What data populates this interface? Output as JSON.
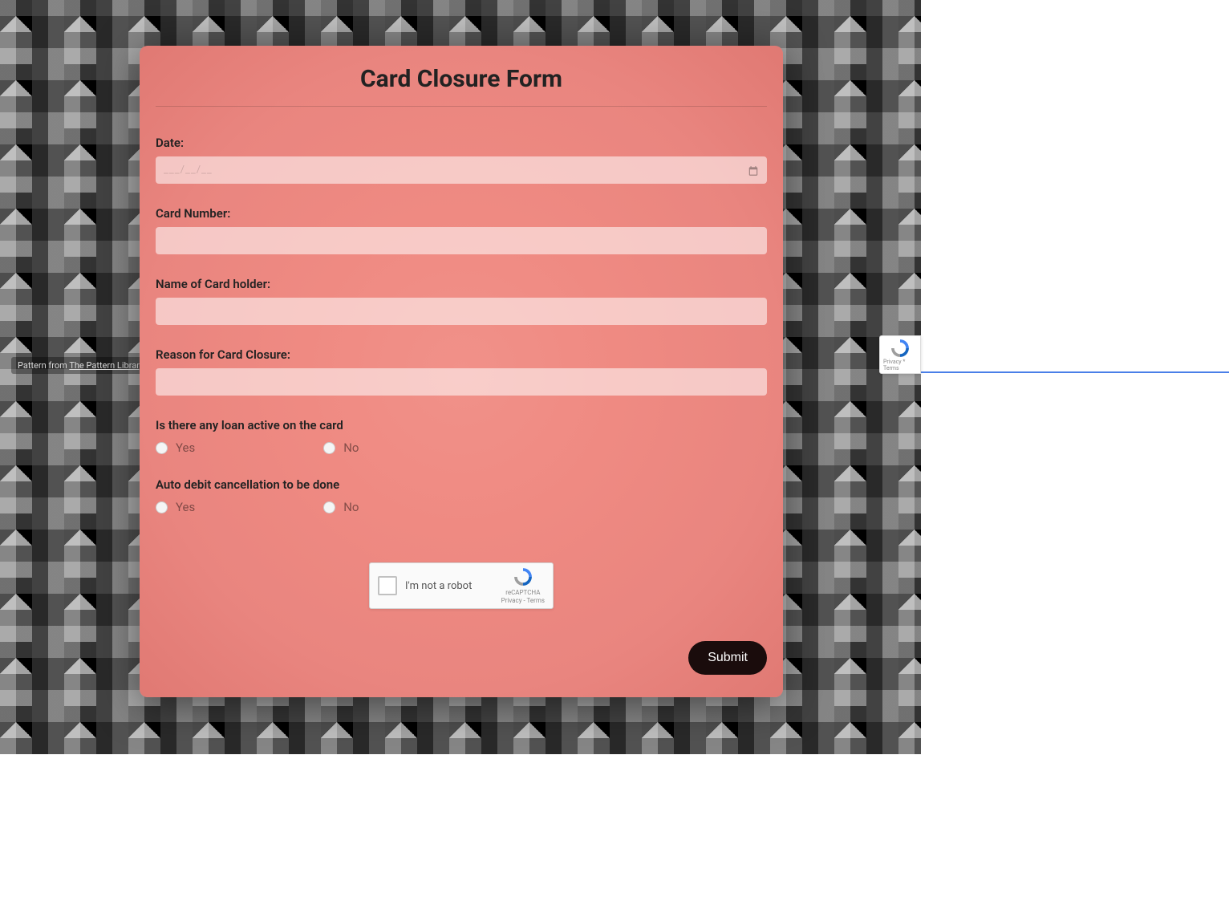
{
  "form": {
    "title": "Card Closure Form",
    "fields": {
      "date": {
        "label": "Date:",
        "placeholder": "___/__/__"
      },
      "card_number": {
        "label": "Card Number:"
      },
      "card_holder": {
        "label": "Name of Card holder:"
      },
      "reason": {
        "label": "Reason for Card Closure:"
      }
    },
    "radio_groups": {
      "loan_active": {
        "question": "Is there any loan active on the card",
        "options": {
          "yes": "Yes",
          "no": "No"
        }
      },
      "auto_debit": {
        "question": "Auto debit cancellation to be done",
        "options": {
          "yes": "Yes",
          "no": "No"
        }
      }
    },
    "captcha": {
      "label": "I'm not a robot",
      "brand": "reCAPTCHA",
      "links": "Privacy - Terms"
    },
    "submit_label": "Submit"
  },
  "pattern_credit": {
    "prefix": "Pattern from ",
    "link_text": "The Pattern Library"
  },
  "recaptcha_badge": {
    "links": "Privacy * Terms"
  }
}
